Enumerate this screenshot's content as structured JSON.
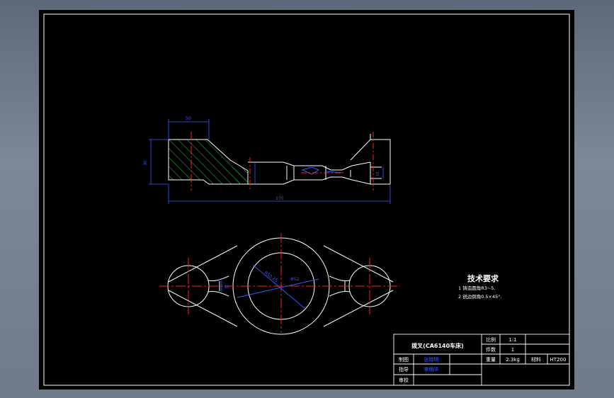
{
  "colors": {
    "background": "#000000",
    "frame": "#ffffff",
    "outline": "#ffffff",
    "centerline": "#ff2020",
    "dimension": "#3a5bff",
    "hatch": "#1fae2c",
    "fill_blue": "#2f6bff"
  },
  "views": {
    "front": {
      "dim_top": "50",
      "dim_left": "30",
      "dim_bottom": "170",
      "dim_slot": "10"
    },
    "plan": {
      "dim_large_radius": "R50.25",
      "dim_inner": "Φ52",
      "dim_neck": "10"
    }
  },
  "technical_requirements": {
    "title": "技术要求",
    "item1": "1 铸造圆角R3~5.",
    "item2": "2 锐边倒角0.5×45°."
  },
  "title_block": {
    "part_name": "拨叉(CA6140车床)",
    "scale_label": "比例",
    "scale_value": "1:1",
    "quantity_label": "件数",
    "quantity_value": "1",
    "weight_label": "重量",
    "weight_value": "2.3kg",
    "material_label": "材料",
    "material_value": "HT200",
    "drawn_label": "制图",
    "drawn_name": "张晓明",
    "guide_label": "指导",
    "guide_name": "李明华",
    "review_label": "审校"
  }
}
